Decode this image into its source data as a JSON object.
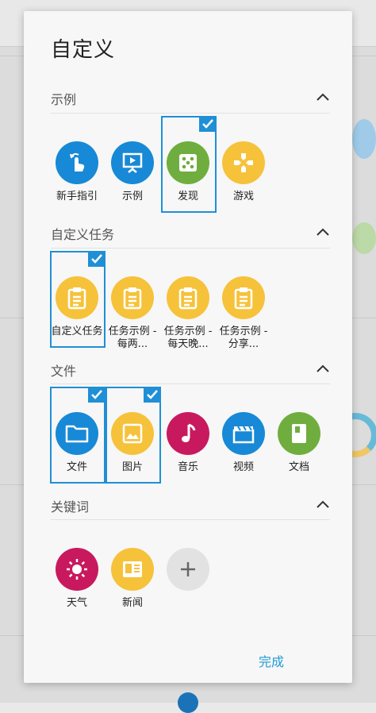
{
  "dialog": {
    "title": "自定义",
    "done_label": "完成"
  },
  "sections": [
    {
      "title": "示例",
      "items": [
        {
          "label": "新手指引",
          "icon": "hand-pointer-icon",
          "color": "#1789d6",
          "selected": false
        },
        {
          "label": "示例",
          "icon": "presentation-icon",
          "color": "#1789d6",
          "selected": false
        },
        {
          "label": "发现",
          "icon": "dice-icon",
          "color": "#6fae3e",
          "selected": true
        },
        {
          "label": "游戏",
          "icon": "gamepad-icon",
          "color": "#f6c23a",
          "selected": false
        }
      ]
    },
    {
      "title": "自定义任务",
      "items": [
        {
          "label": "自定义任务",
          "icon": "clipboard-icon",
          "color": "#f6c23a",
          "selected": true
        },
        {
          "label": "任务示例 - 每两...",
          "icon": "clipboard-icon",
          "color": "#f6c23a",
          "selected": false
        },
        {
          "label": "任务示例 - 每天晚...",
          "icon": "clipboard-icon",
          "color": "#f6c23a",
          "selected": false
        },
        {
          "label": "任务示例 - 分享...",
          "icon": "clipboard-icon",
          "color": "#f6c23a",
          "selected": false
        }
      ]
    },
    {
      "title": "文件",
      "items": [
        {
          "label": "文件",
          "icon": "folder-icon",
          "color": "#1789d6",
          "selected": true
        },
        {
          "label": "图片",
          "icon": "image-icon",
          "color": "#f6c23a",
          "selected": true
        },
        {
          "label": "音乐",
          "icon": "music-note-icon",
          "color": "#c8195f",
          "selected": false
        },
        {
          "label": "视频",
          "icon": "clapperboard-icon",
          "color": "#1789d6",
          "selected": false
        },
        {
          "label": "文档",
          "icon": "document-icon",
          "color": "#6fae3e",
          "selected": false
        }
      ]
    },
    {
      "title": "关键词",
      "items": [
        {
          "label": "天气",
          "icon": "sun-icon",
          "color": "#c8195f",
          "selected": false
        },
        {
          "label": "新闻",
          "icon": "newspaper-icon",
          "color": "#f6c23a",
          "selected": false
        },
        {
          "label": "",
          "icon": "plus-icon",
          "color": "#e2e2e2",
          "selected": false
        }
      ]
    }
  ]
}
